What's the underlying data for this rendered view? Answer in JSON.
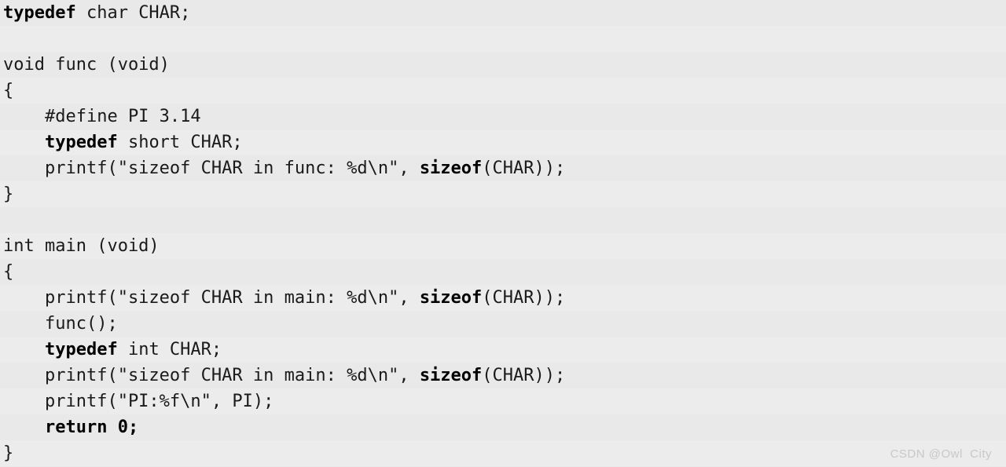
{
  "editor": {
    "language": "c",
    "background_color": "#e9e9e9",
    "stripe_color": "#ecececec",
    "text_color": "#1a1a1a",
    "font_size_px": 22,
    "line_height_px": 33,
    "stripe_rows": [
      1,
      3,
      5,
      7,
      9,
      11,
      13,
      15,
      17
    ],
    "lines": [
      {
        "indent": 0,
        "tokens": [
          {
            "text": "typedef",
            "bold": true
          },
          {
            "text": " char CHAR;",
            "bold": false
          }
        ]
      },
      {
        "indent": 0,
        "tokens": []
      },
      {
        "indent": 0,
        "tokens": [
          {
            "text": "void func (void)",
            "bold": false
          }
        ]
      },
      {
        "indent": 0,
        "tokens": [
          {
            "text": "{",
            "bold": false
          }
        ]
      },
      {
        "indent": 4,
        "tokens": [
          {
            "text": "#define PI 3.14",
            "bold": false
          }
        ]
      },
      {
        "indent": 4,
        "tokens": [
          {
            "text": "typedef",
            "bold": true
          },
          {
            "text": " short CHAR;",
            "bold": false
          }
        ]
      },
      {
        "indent": 4,
        "tokens": [
          {
            "text": "printf(\"sizeof CHAR in func: %d\\n\", ",
            "bold": false
          },
          {
            "text": "sizeof",
            "bold": true
          },
          {
            "text": "(CHAR));",
            "bold": false
          }
        ]
      },
      {
        "indent": 0,
        "tokens": [
          {
            "text": "}",
            "bold": false
          }
        ]
      },
      {
        "indent": 0,
        "tokens": []
      },
      {
        "indent": 0,
        "tokens": [
          {
            "text": "int main (void)",
            "bold": false
          }
        ]
      },
      {
        "indent": 0,
        "tokens": [
          {
            "text": "{",
            "bold": false
          }
        ]
      },
      {
        "indent": 4,
        "tokens": [
          {
            "text": "printf(\"sizeof CHAR in main: %d\\n\", ",
            "bold": false
          },
          {
            "text": "sizeof",
            "bold": true
          },
          {
            "text": "(CHAR));",
            "bold": false
          }
        ]
      },
      {
        "indent": 4,
        "tokens": [
          {
            "text": "func();",
            "bold": false
          }
        ]
      },
      {
        "indent": 4,
        "tokens": [
          {
            "text": "typedef",
            "bold": true
          },
          {
            "text": " int CHAR;",
            "bold": false
          }
        ]
      },
      {
        "indent": 4,
        "tokens": [
          {
            "text": "printf(\"sizeof CHAR in main: %d\\n\", ",
            "bold": false
          },
          {
            "text": "sizeof",
            "bold": true
          },
          {
            "text": "(CHAR));",
            "bold": false
          }
        ]
      },
      {
        "indent": 4,
        "tokens": [
          {
            "text": "printf(\"PI:%f\\n\", PI);",
            "bold": false
          }
        ]
      },
      {
        "indent": 4,
        "tokens": [
          {
            "text": "return 0;",
            "bold": true
          }
        ]
      },
      {
        "indent": 0,
        "tokens": [
          {
            "text": "}",
            "bold": false
          }
        ]
      }
    ]
  },
  "watermark": {
    "text": "CSDN @Owl  City",
    "color": "#c8c8c8"
  }
}
